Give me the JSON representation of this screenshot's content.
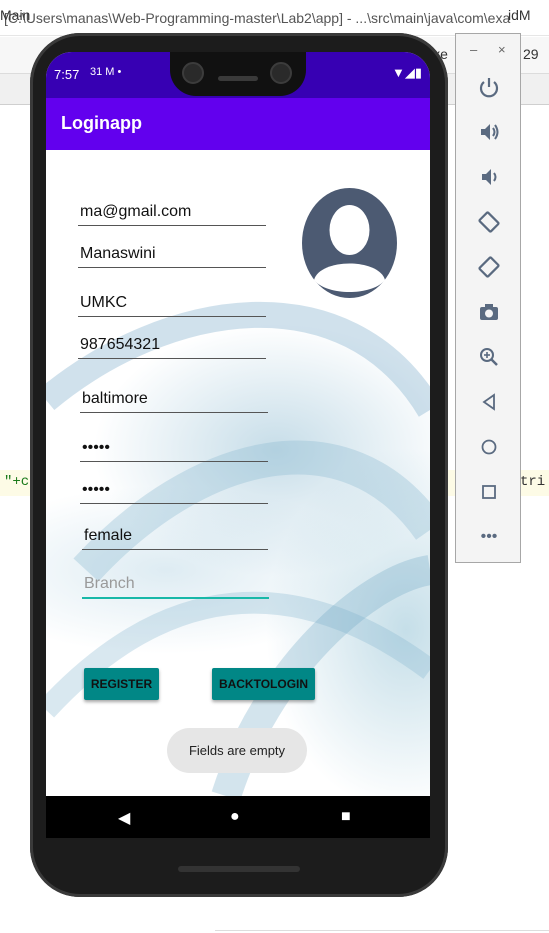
{
  "ide": {
    "title": "[C:\\Users\\manas\\Web-Programming-master\\Lab2\\app] - ...\\src\\main\\java\\com\\exa",
    "toolbar_right_1": "ixe",
    "toolbar_right_2": "29",
    "tab_left": "Main",
    "tab_right": "idM",
    "code_left": "\"+c",
    "code_right": "tri"
  },
  "status_bar": {
    "time": "7:57",
    "icons": "31 M •",
    "right_icons": "▼◢▮"
  },
  "app_bar": {
    "title": "Loginapp"
  },
  "form": {
    "email": "ma@gmail.com",
    "name": "Manaswini",
    "university": "UMKC",
    "phone": "987654321",
    "city": "baltimore",
    "password": "•••••",
    "confirm_password": "•••••",
    "gender": "female",
    "branch_placeholder": "Branch"
  },
  "buttons": {
    "register": "REGISTER",
    "back_to_login": "BACKTOLOGIN"
  },
  "toast": {
    "message": "Fields are empty"
  },
  "emulator_panel": {
    "minimize": "–",
    "close": "×",
    "tools": [
      "power-icon",
      "volume-up-icon",
      "volume-down-icon",
      "rotate-left-icon",
      "rotate-right-icon",
      "camera-icon",
      "zoom-icon",
      "back-icon",
      "home-icon",
      "overview-icon",
      "more-icon"
    ],
    "more_label": "•••"
  },
  "colors": {
    "status_bar": "#3700b3",
    "app_bar": "#6200ee",
    "button": "#018786",
    "field_active": "#18b8a8",
    "avatar": "#4c5a72"
  }
}
